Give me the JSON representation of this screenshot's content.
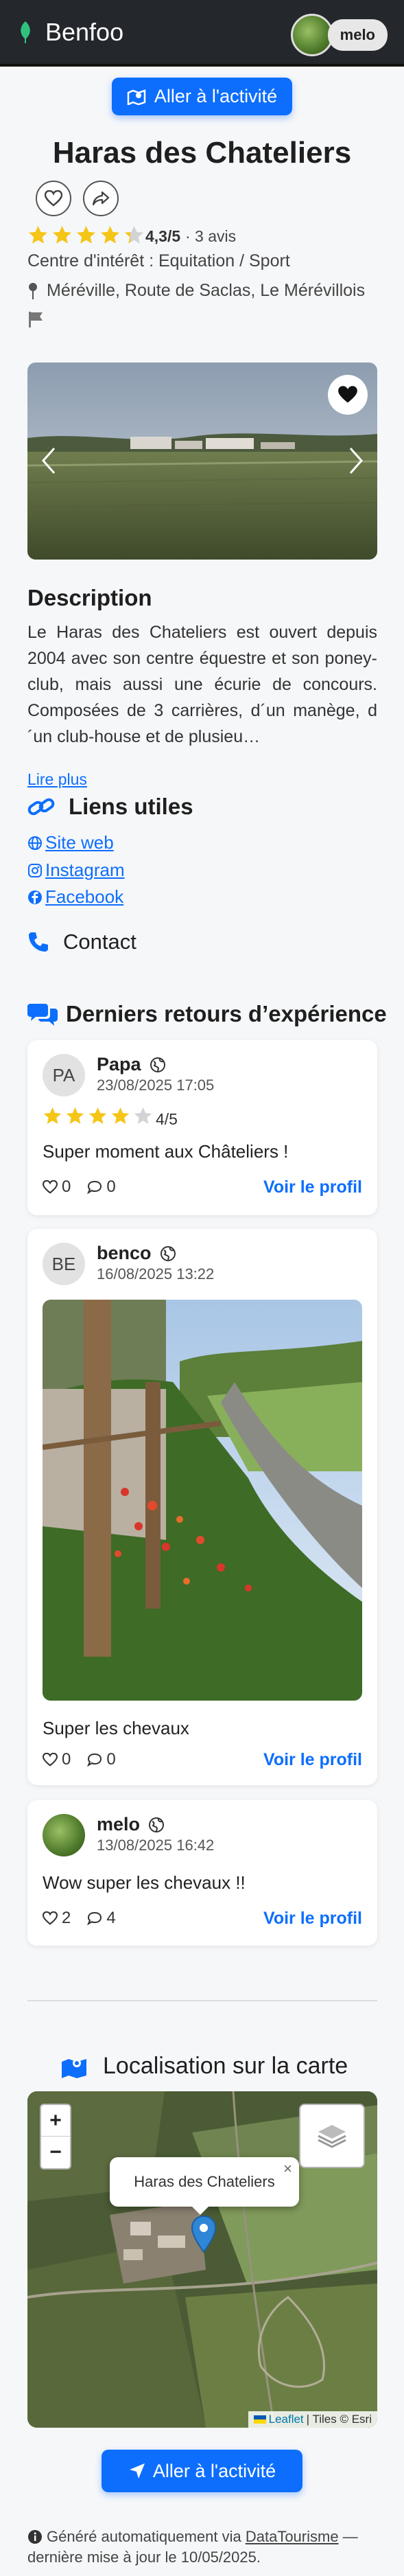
{
  "header": {
    "brand": "Benfoo",
    "username": "melo"
  },
  "activity_button": {
    "label": "Aller à l'activité"
  },
  "place": {
    "title": "Haras des Chateliers",
    "rating": "4,3/5",
    "reviews": "· 3 avis",
    "rating_value": 4.3,
    "category": "Centre d'intérêt : Equitation / Sport",
    "address": "Méréville, Route de Saclas, Le Mérévillois"
  },
  "description": {
    "heading": "Description",
    "text": "Le Haras des Chateliers est ouvert depuis 2004 avec son centre équestre et son poney-club, mais aussi une écurie de concours. Composées de 3 carrières, d´un manège, d´un club-house et de plusieu…",
    "read_more": "Lire plus"
  },
  "links": {
    "heading": "Liens utiles",
    "items": [
      " Site web",
      " Instagram",
      " Facebook"
    ]
  },
  "contact": {
    "heading": "Contact"
  },
  "feedback": {
    "heading": "Derniers retours d’expérience",
    "items": [
      {
        "initials": "PA",
        "name": "Papa",
        "date": "23/08/2025 17:05",
        "rating": "4/5",
        "rating_value": 4,
        "comment": "Super moment aux Châteliers !",
        "likes": "0",
        "comments": "0",
        "profile": "Voir le profil"
      },
      {
        "initials": "BE",
        "name": "benco",
        "date": "16/08/2025 13:22",
        "comment": "Super les chevaux",
        "likes": "0",
        "comments": "0",
        "profile": "Voir le profil"
      },
      {
        "name": "melo",
        "date": "13/08/2025 16:42",
        "comment": "Wow super les chevaux !!",
        "likes": "2",
        "comments": "4",
        "profile": "Voir le profil"
      }
    ]
  },
  "map": {
    "heading": "Localisation sur la carte",
    "popup": "Haras des Chateliers",
    "zoom_in": "+",
    "zoom_out": "−",
    "attribution_link": "Leaflet",
    "attribution_rest": "| Tiles © Esri"
  },
  "footer": {
    "prefix": "Généré automatiquement via ",
    "source": "DataTourisme",
    "suffix": " — dernière mise à jour le 10/05/2025."
  },
  "colors": {
    "primary": "#0d6efd",
    "star": "#f5c518",
    "topbar": "#24272b"
  }
}
